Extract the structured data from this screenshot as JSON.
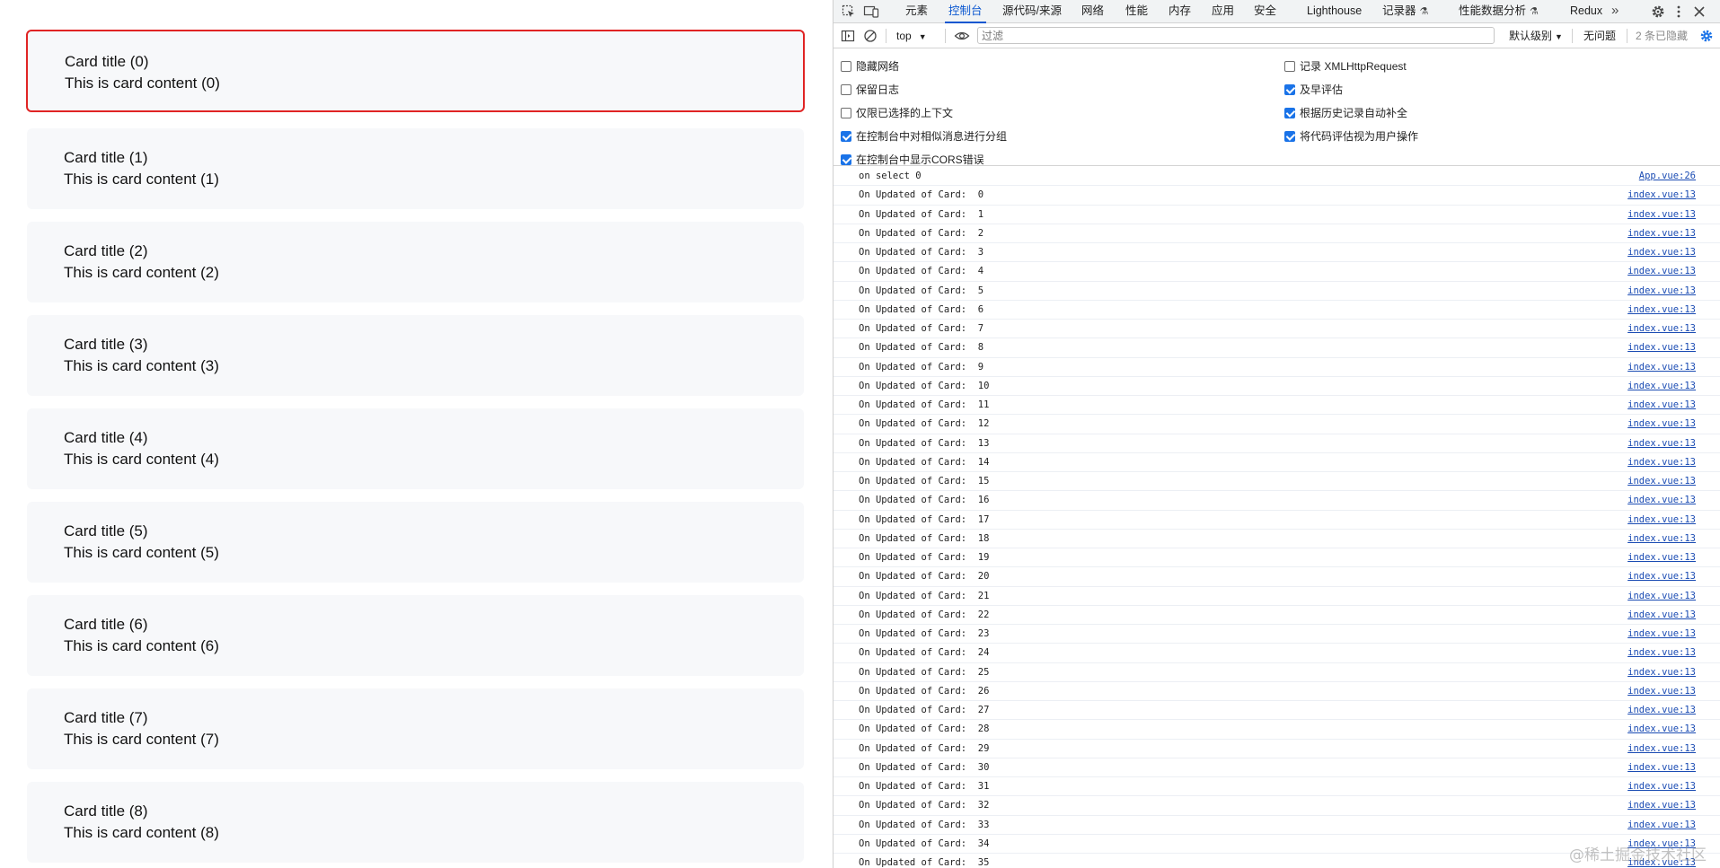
{
  "app": {
    "cards": [
      {
        "title": "Card title (0)",
        "content": "This is card content (0)",
        "selected": true
      },
      {
        "title": "Card title (1)",
        "content": "This is card content (1)",
        "selected": false
      },
      {
        "title": "Card title (2)",
        "content": "This is card content (2)",
        "selected": false
      },
      {
        "title": "Card title (3)",
        "content": "This is card content (3)",
        "selected": false
      },
      {
        "title": "Card title (4)",
        "content": "This is card content (4)",
        "selected": false
      },
      {
        "title": "Card title (5)",
        "content": "This is card content (5)",
        "selected": false
      },
      {
        "title": "Card title (6)",
        "content": "This is card content (6)",
        "selected": false
      },
      {
        "title": "Card title (7)",
        "content": "This is card content (7)",
        "selected": false
      },
      {
        "title": "Card title (8)",
        "content": "This is card content (8)",
        "selected": false
      }
    ]
  },
  "devtools": {
    "tabs": [
      {
        "label": "元素",
        "active": false
      },
      {
        "label": "控制台",
        "active": true
      },
      {
        "label": "源代码/来源",
        "active": false
      },
      {
        "label": "网络",
        "active": false
      },
      {
        "label": "性能",
        "active": false
      },
      {
        "label": "内存",
        "active": false
      },
      {
        "label": "应用",
        "active": false
      },
      {
        "label": "安全",
        "active": false
      },
      {
        "label": "Lighthouse",
        "active": false
      },
      {
        "label": "记录器",
        "active": false
      },
      {
        "label": "性能数据分析",
        "active": false
      },
      {
        "label": "Redux",
        "active": false
      }
    ],
    "icons": {
      "inspect": "inspect-element-icon",
      "device": "device-toolbar-icon",
      "more_tabs": "chevron-double-right-icon",
      "settings": "gear-icon",
      "menu": "kebab-menu-icon",
      "close": "close-icon",
      "sidebar": "sidebar-toggle-icon",
      "clear": "clear-console-icon",
      "eye": "eye-icon",
      "console_settings": "gear-icon"
    },
    "toolbar": {
      "context": "top",
      "filter_placeholder": "过滤",
      "filter_value": "",
      "level": "默认级别",
      "issues": "无问题",
      "hidden": "2 条已隐藏"
    },
    "settings": {
      "left": [
        {
          "label": "隐藏网络",
          "checked": false
        },
        {
          "label": "保留日志",
          "checked": false
        },
        {
          "label": "仅限已选择的上下文",
          "checked": false
        },
        {
          "label": "在控制台中对相似消息进行分组",
          "checked": true
        },
        {
          "label": "在控制台中显示CORS错误",
          "checked": true
        }
      ],
      "right": [
        {
          "label": "记录 XMLHttpRequest",
          "checked": false
        },
        {
          "label": "及早评估",
          "checked": true
        },
        {
          "label": "根据历史记录自动补全",
          "checked": true
        },
        {
          "label": "将代码评估视为用户操作",
          "checked": true
        }
      ]
    },
    "console": {
      "logs": [
        {
          "message": "on select 0",
          "source": "App.vue:26"
        },
        {
          "message": "On Updated of Card:  0",
          "source": "index.vue:13"
        },
        {
          "message": "On Updated of Card:  1",
          "source": "index.vue:13"
        },
        {
          "message": "On Updated of Card:  2",
          "source": "index.vue:13"
        },
        {
          "message": "On Updated of Card:  3",
          "source": "index.vue:13"
        },
        {
          "message": "On Updated of Card:  4",
          "source": "index.vue:13"
        },
        {
          "message": "On Updated of Card:  5",
          "source": "index.vue:13"
        },
        {
          "message": "On Updated of Card:  6",
          "source": "index.vue:13"
        },
        {
          "message": "On Updated of Card:  7",
          "source": "index.vue:13"
        },
        {
          "message": "On Updated of Card:  8",
          "source": "index.vue:13"
        },
        {
          "message": "On Updated of Card:  9",
          "source": "index.vue:13"
        },
        {
          "message": "On Updated of Card:  10",
          "source": "index.vue:13"
        },
        {
          "message": "On Updated of Card:  11",
          "source": "index.vue:13"
        },
        {
          "message": "On Updated of Card:  12",
          "source": "index.vue:13"
        },
        {
          "message": "On Updated of Card:  13",
          "source": "index.vue:13"
        },
        {
          "message": "On Updated of Card:  14",
          "source": "index.vue:13"
        },
        {
          "message": "On Updated of Card:  15",
          "source": "index.vue:13"
        },
        {
          "message": "On Updated of Card:  16",
          "source": "index.vue:13"
        },
        {
          "message": "On Updated of Card:  17",
          "source": "index.vue:13"
        },
        {
          "message": "On Updated of Card:  18",
          "source": "index.vue:13"
        },
        {
          "message": "On Updated of Card:  19",
          "source": "index.vue:13"
        },
        {
          "message": "On Updated of Card:  20",
          "source": "index.vue:13"
        },
        {
          "message": "On Updated of Card:  21",
          "source": "index.vue:13"
        },
        {
          "message": "On Updated of Card:  22",
          "source": "index.vue:13"
        },
        {
          "message": "On Updated of Card:  23",
          "source": "index.vue:13"
        },
        {
          "message": "On Updated of Card:  24",
          "source": "index.vue:13"
        },
        {
          "message": "On Updated of Card:  25",
          "source": "index.vue:13"
        },
        {
          "message": "On Updated of Card:  26",
          "source": "index.vue:13"
        },
        {
          "message": "On Updated of Card:  27",
          "source": "index.vue:13"
        },
        {
          "message": "On Updated of Card:  28",
          "source": "index.vue:13"
        },
        {
          "message": "On Updated of Card:  29",
          "source": "index.vue:13"
        },
        {
          "message": "On Updated of Card:  30",
          "source": "index.vue:13"
        },
        {
          "message": "On Updated of Card:  31",
          "source": "index.vue:13"
        },
        {
          "message": "On Updated of Card:  32",
          "source": "index.vue:13"
        },
        {
          "message": "On Updated of Card:  33",
          "source": "index.vue:13"
        },
        {
          "message": "On Updated of Card:  34",
          "source": "index.vue:13"
        },
        {
          "message": "On Updated of Card:  35",
          "source": "index.vue:13"
        }
      ]
    }
  },
  "watermark": "@稀土掘金技术社区",
  "colors": {
    "selected_border": "#e02424",
    "card_bg": "#f7f8fa",
    "accent": "#0b57d0",
    "link": "#1a4bb3"
  }
}
